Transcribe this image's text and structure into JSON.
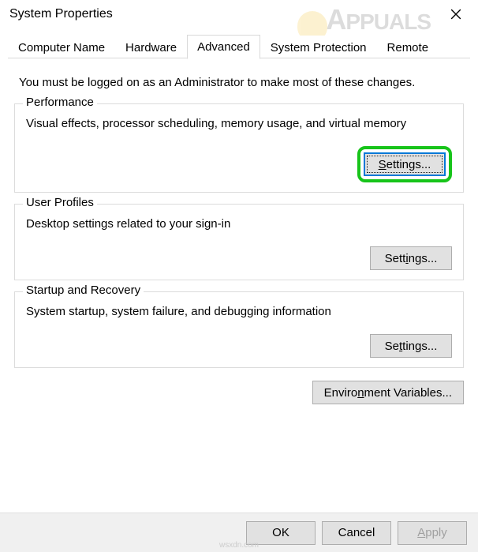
{
  "window": {
    "title": "System Properties"
  },
  "tabs": {
    "computer_name": "Computer Name",
    "hardware": "Hardware",
    "advanced": "Advanced",
    "system_protection": "System Protection",
    "remote": "Remote"
  },
  "intro": "You must be logged on as an Administrator to make most of these changes.",
  "groups": {
    "performance": {
      "legend": "Performance",
      "desc": "Visual effects, processor scheduling, memory usage, and virtual memory",
      "button_prefix": "S",
      "button_rest": "ettings..."
    },
    "user_profiles": {
      "legend": "User Profiles",
      "desc": "Desktop settings related to your sign-in",
      "button_prefix": "Sett",
      "button_rest": "ings..."
    },
    "startup": {
      "legend": "Startup and Recovery",
      "desc": "System startup, system failure, and debugging information",
      "button_prefix": "Sett",
      "button_rest": "ings..."
    }
  },
  "env_button_prefix": "Enviro",
  "env_button_rest": "nment Variables...",
  "buttons": {
    "ok": "OK",
    "cancel": "Cancel",
    "apply_prefix": "A",
    "apply_rest": "pply"
  },
  "watermark": "APPUALS",
  "footer": "wsxdn.com"
}
